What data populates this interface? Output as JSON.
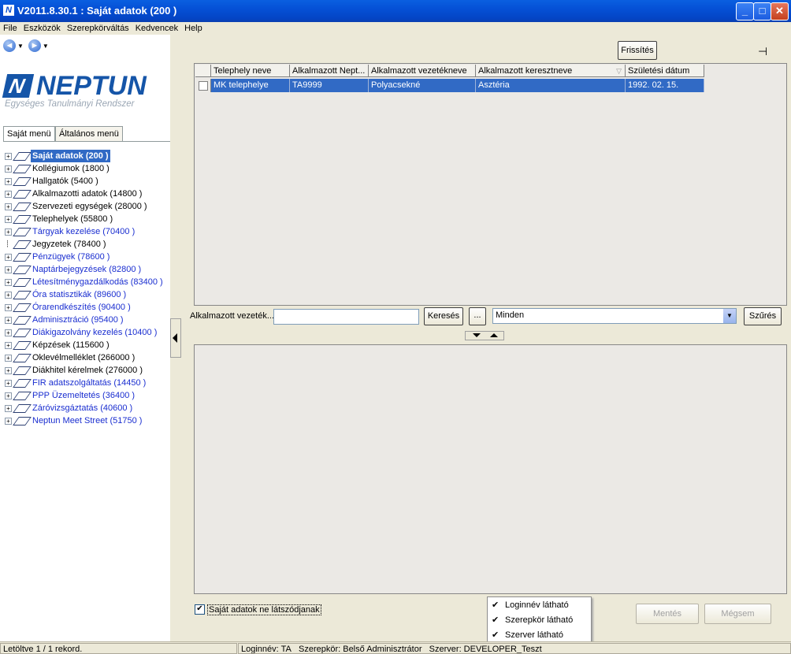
{
  "window": {
    "title": "V2011.8.30.1 : Saját adatok (200  )",
    "app_icon": "N"
  },
  "menu": [
    "File",
    "Eszközök",
    "Szerepkörváltás",
    "Kedvencek",
    "Help"
  ],
  "logo": {
    "word": "NEPTUN",
    "mark": "N",
    "subtitle": "Egységes Tanulmányi Rendszer"
  },
  "left_tabs": [
    "Saját menü",
    "Általános menü"
  ],
  "tree": [
    {
      "label": "Saját adatok (200  )",
      "style": "sel"
    },
    {
      "label": "Kollégiumok (1800  )",
      "style": "black"
    },
    {
      "label": "Hallgatók (5400  )",
      "style": "black"
    },
    {
      "label": "Alkalmazotti adatok (14800  )",
      "style": "black"
    },
    {
      "label": "Szervezeti egységek (28000  )",
      "style": "black"
    },
    {
      "label": "Telephelyek (55800  )",
      "style": "black"
    },
    {
      "label": "Tárgyak kezelése (70400  )",
      "style": "blue"
    },
    {
      "label": "Jegyzetek (78400  )",
      "style": "black",
      "leaf": true
    },
    {
      "label": "Pénzügyek (78600  )",
      "style": "blue"
    },
    {
      "label": "Naptárbejegyzések (82800  )",
      "style": "blue"
    },
    {
      "label": "Létesítménygazdálkodás (83400  )",
      "style": "blue"
    },
    {
      "label": "Óra statisztikák (89600  )",
      "style": "blue"
    },
    {
      "label": "Órarendkészítés (90400  )",
      "style": "blue"
    },
    {
      "label": "Adminisztráció (95400  )",
      "style": "blue"
    },
    {
      "label": "Diákigazolvány kezelés (10400  )",
      "style": "blue"
    },
    {
      "label": "Képzések (115600  )",
      "style": "black"
    },
    {
      "label": "Oklevélmelléklet (266000  )",
      "style": "black"
    },
    {
      "label": "Diákhitel kérelmek (276000  )",
      "style": "black"
    },
    {
      "label": "FIR adatszolgáltatás (14450  )",
      "style": "blue"
    },
    {
      "label": "PPP Üzemeltetés (36400  )",
      "style": "blue"
    },
    {
      "label": "Záróvizsgáztatás (40600  )",
      "style": "blue"
    },
    {
      "label": "Neptun Meet Street (51750  )",
      "style": "blue"
    }
  ],
  "toolbar": {
    "refresh": "Frissítés"
  },
  "grid": {
    "columns": [
      "Telephely neve",
      "Alkalmazott Nept...",
      "Alkalmazott vezetékneve",
      "Alkalmazott keresztneve",
      "Születési dátum"
    ],
    "rows": [
      [
        "MK telephelye",
        "TA9999",
        "Polyacsekné",
        "Asztéria",
        "1992. 02. 15."
      ]
    ]
  },
  "filter": {
    "label": "Alkalmazott vezeték...",
    "value": "",
    "search": "Keresés",
    "more": "...",
    "select_value": "Minden",
    "filter_button": "Szűrés"
  },
  "bottom": {
    "checkbox_label": "Saját adatok ne látszódjanak",
    "save": "Mentés",
    "cancel": "Mégsem"
  },
  "context_menu": [
    "Loginnév látható",
    "Szerepkör látható",
    "Szerver látható"
  ],
  "status": {
    "records": "Letöltve 1 / 1 rekord.",
    "login": "Loginnév: TA",
    "role": "Szerepkör: Belső Adminisztrátor",
    "server": "Szerver: DEVELOPER_Teszt"
  },
  "colors": {
    "selection": "#316ac5",
    "link_blue": "#1a2ed0",
    "brand": "#1555a8"
  }
}
